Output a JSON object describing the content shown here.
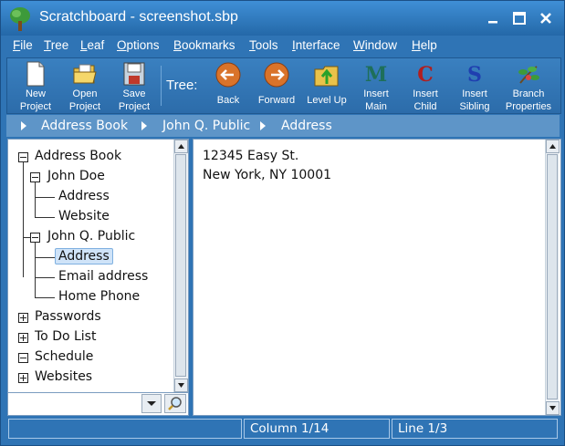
{
  "window": {
    "title": "Scratchboard - screenshot.sbp"
  },
  "menu": [
    {
      "label": "File",
      "mn": "F",
      "rest": "ile"
    },
    {
      "label": "Tree",
      "mn": "T",
      "rest": "ree"
    },
    {
      "label": "Leaf",
      "mn": "L",
      "rest": "eaf"
    },
    {
      "label": "Options",
      "mn": "O",
      "rest": "ptions"
    },
    {
      "label": "Bookmarks",
      "mn": "B",
      "rest": "ookmarks"
    },
    {
      "label": "Tools",
      "mn": "T",
      "rest": "ools"
    },
    {
      "label": "Interface",
      "mn": "I",
      "rest": "nterface"
    },
    {
      "label": "Window",
      "mn": "W",
      "rest": "indow"
    },
    {
      "label": "Help",
      "mn": "H",
      "rest": "elp"
    }
  ],
  "toolbar": {
    "new_project": [
      "New",
      "Project"
    ],
    "open_project": [
      "Open",
      "Project"
    ],
    "save_project": [
      "Save",
      "Project"
    ],
    "tree_label": "Tree:",
    "back": "Back",
    "forward": "Forward",
    "level_up": "Level Up",
    "insert_main": [
      "Insert",
      "Main"
    ],
    "insert_child": [
      "Insert",
      "Child"
    ],
    "insert_sibling": [
      "Insert",
      "Sibling"
    ],
    "branch_properties": [
      "Branch",
      "Properties"
    ],
    "glyph_main": "M",
    "glyph_child": "C",
    "glyph_sibling": "S"
  },
  "breadcrumb": [
    "Address Book",
    "John Q. Public",
    "Address"
  ],
  "tree": {
    "address_book": "Address Book",
    "john_doe": "John Doe",
    "jd_address": "Address",
    "jd_website": "Website",
    "john_q_public": "John Q. Public",
    "jqp_address": "Address",
    "jqp_email": "Email address",
    "jqp_home_phone": "Home Phone",
    "passwords": "Passwords",
    "todo": "To Do List",
    "schedule": "Schedule",
    "websites": "Websites"
  },
  "content": {
    "line1": "12345 Easy St.",
    "line2": "New York, NY 10001"
  },
  "status": {
    "column": "Column 1/14",
    "line": "Line 1/3"
  },
  "colors": {
    "chrome": "#2f74b5",
    "selection": "#cfe3f8"
  }
}
